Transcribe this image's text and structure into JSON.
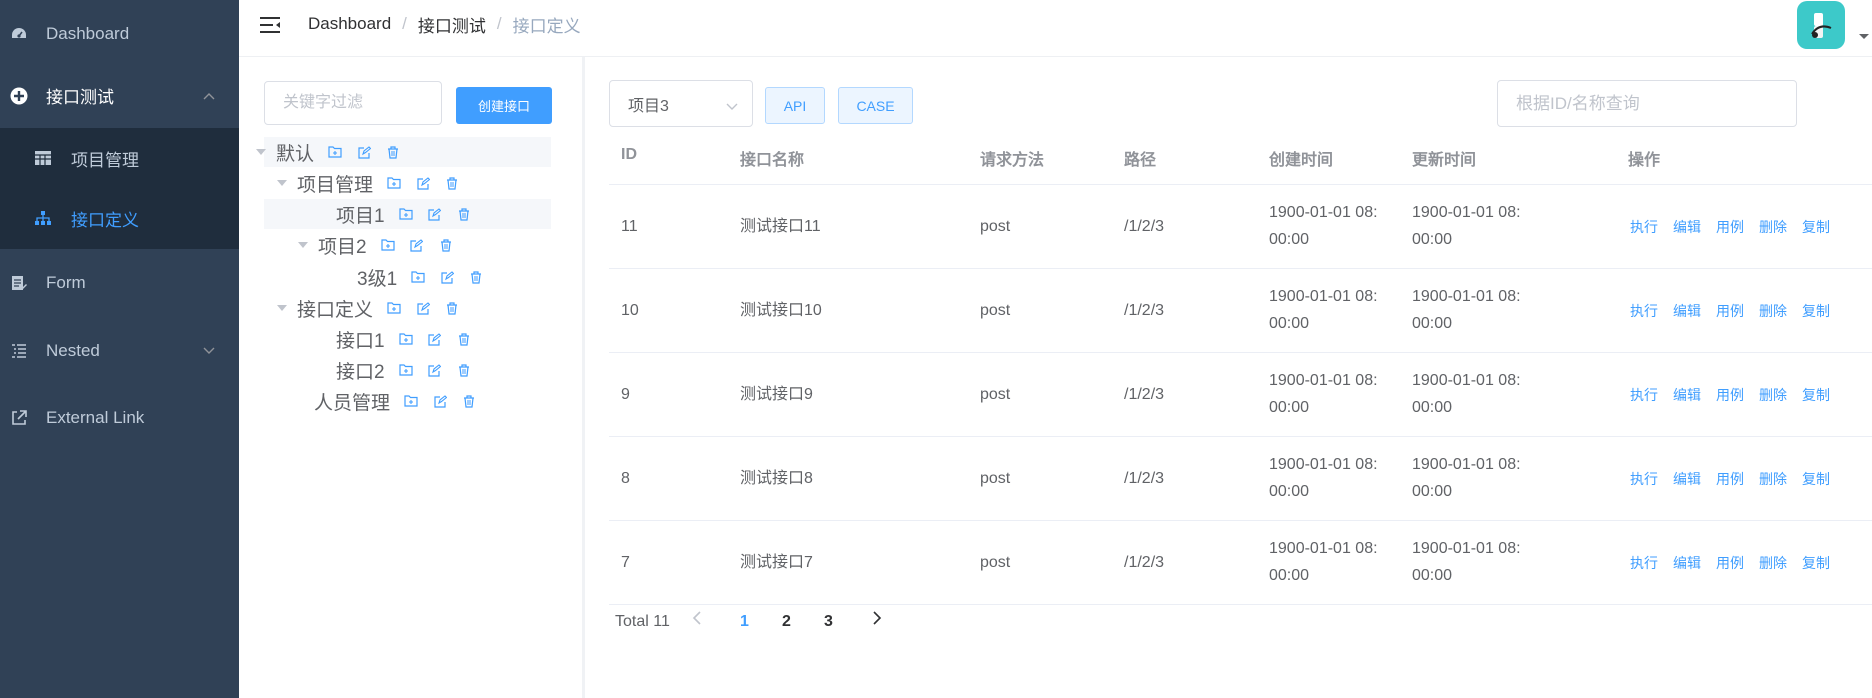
{
  "sidebar": {
    "items": [
      {
        "label": "Dashboard",
        "icon": "dashboard-icon"
      },
      {
        "label": "接口测试",
        "icon": "plus-circle-icon"
      },
      {
        "label": "Form",
        "icon": "form-icon"
      },
      {
        "label": "Nested",
        "icon": "nested-list-icon"
      },
      {
        "label": "External Link",
        "icon": "external-link-icon"
      }
    ],
    "submenu": [
      {
        "label": "项目管理",
        "icon": "table-icon"
      },
      {
        "label": "接口定义",
        "icon": "tree-icon"
      }
    ]
  },
  "navbar": {
    "breadcrumb": [
      "Dashboard",
      "接口测试",
      "接口定义"
    ],
    "breadcrumb_sep": "/"
  },
  "tree": {
    "filter_placeholder": "关键字过滤",
    "create_label": "创建接口",
    "nodes": [
      "默认",
      "项目管理",
      "项目1",
      "项目2",
      "3级1",
      "接口定义",
      "接口1",
      "接口2",
      "人员管理"
    ]
  },
  "toolbar": {
    "select_value": "项目3",
    "api_label": "API",
    "case_label": "CASE",
    "search_placeholder": "根据ID/名称查询"
  },
  "table": {
    "headers": [
      "ID",
      "接口名称",
      "请求方法",
      "路径",
      "创建时间",
      "更新时间",
      "操作"
    ],
    "rows": [
      {
        "id": "11",
        "name": "测试接口11",
        "method": "post",
        "path": "/1/2/3",
        "created_1": "1900-01-01 08:",
        "created_2": "00:00",
        "updated_1": "1900-01-01 08:",
        "updated_2": "00:00"
      },
      {
        "id": "10",
        "name": "测试接口10",
        "method": "post",
        "path": "/1/2/3",
        "created_1": "1900-01-01 08:",
        "created_2": "00:00",
        "updated_1": "1900-01-01 08:",
        "updated_2": "00:00"
      },
      {
        "id": "9",
        "name": "测试接口9",
        "method": "post",
        "path": "/1/2/3",
        "created_1": "1900-01-01 08:",
        "created_2": "00:00",
        "updated_1": "1900-01-01 08:",
        "updated_2": "00:00"
      },
      {
        "id": "8",
        "name": "测试接口8",
        "method": "post",
        "path": "/1/2/3",
        "created_1": "1900-01-01 08:",
        "created_2": "00:00",
        "updated_1": "1900-01-01 08:",
        "updated_2": "00:00"
      },
      {
        "id": "7",
        "name": "测试接口7",
        "method": "post",
        "path": "/1/2/3",
        "created_1": "1900-01-01 08:",
        "created_2": "00:00",
        "updated_1": "1900-01-01 08:",
        "updated_2": "00:00"
      }
    ],
    "actions": [
      "执行",
      "编辑",
      "用例",
      "删除",
      "复制"
    ]
  },
  "pagination": {
    "total": "Total 11",
    "pages": [
      "1",
      "2",
      "3"
    ],
    "current": "1"
  },
  "colors": {
    "sidebar": "#304156",
    "submenu": "#1f2d3d",
    "accent": "#409eff"
  }
}
